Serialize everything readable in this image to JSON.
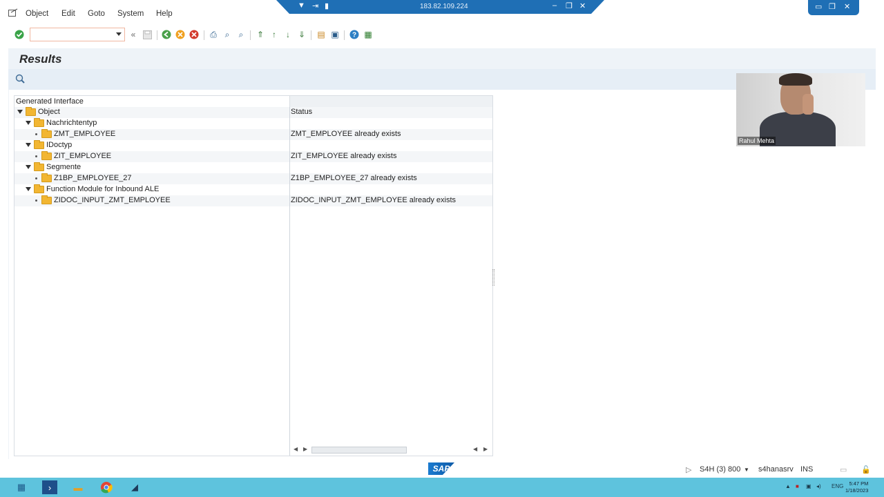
{
  "menu": {
    "items": [
      "Object",
      "Edit",
      "Goto",
      "System",
      "Help"
    ]
  },
  "remote_bar": {
    "ip": "183.82.109.224"
  },
  "toolbar": {
    "command_value": ""
  },
  "page": {
    "title": "Results"
  },
  "tree": {
    "header_left": "Generated Interface",
    "column_object": "Object",
    "column_status": "Status",
    "rows": [
      {
        "level": 1,
        "kind": "folder-open",
        "label": "Nachrichtentyp",
        "status": ""
      },
      {
        "level": 2,
        "kind": "leaf",
        "label": "ZMT_EMPLOYEE",
        "status": "ZMT_EMPLOYEE already exists"
      },
      {
        "level": 1,
        "kind": "folder-open",
        "label": "IDoctyp",
        "status": ""
      },
      {
        "level": 2,
        "kind": "leaf",
        "label": "ZIT_EMPLOYEE",
        "status": "ZIT_EMPLOYEE already exists"
      },
      {
        "level": 1,
        "kind": "folder-open",
        "label": "Segmente",
        "status": ""
      },
      {
        "level": 2,
        "kind": "leaf",
        "label": "Z1BP_EMPLOYEE_27",
        "status": "Z1BP_EMPLOYEE_27 already exists"
      },
      {
        "level": 1,
        "kind": "folder-open",
        "label": "Function Module for Inbound ALE",
        "status": ""
      },
      {
        "level": 2,
        "kind": "leaf",
        "label": "ZIDOC_INPUT_ZMT_EMPLOYEE",
        "status": "ZIDOC_INPUT_ZMT_EMPLOYEE already exists"
      }
    ]
  },
  "webcam": {
    "name": "Rahul Mehta"
  },
  "statusbar": {
    "logo": "SAP",
    "system": "S4H (3) 800",
    "server": "s4hanasrv",
    "mode": "INS"
  },
  "taskbar": {
    "lang": "ENG",
    "time": "5:47 PM",
    "date": "1/18/2023"
  },
  "colors": {
    "accent": "#1f6fb5",
    "taskbar": "#5ec3dd",
    "folder": "#f2b632"
  }
}
